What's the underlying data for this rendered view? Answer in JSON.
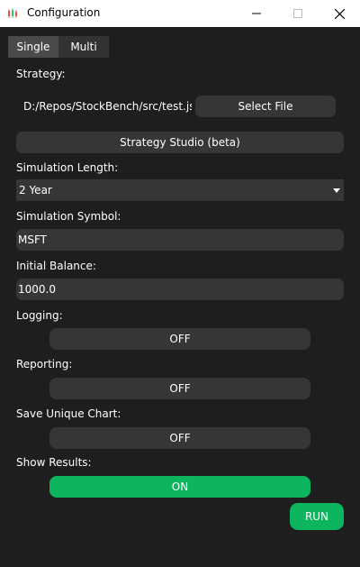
{
  "window": {
    "title": "Configuration",
    "icon": "candlestick-chart-icon",
    "controls": [
      "minimize-icon",
      "maximize-icon",
      "close-icon"
    ]
  },
  "tabs": [
    {
      "label": "Single",
      "active": true
    },
    {
      "label": "Multi",
      "active": false
    }
  ],
  "strategy": {
    "label": "Strategy:",
    "file_path": "D:/Repos/StockBench/src/test.json",
    "select_file_label": "Select File",
    "studio_label": "Strategy Studio (beta)"
  },
  "simulation_length": {
    "label": "Simulation Length:",
    "value": "2 Year"
  },
  "simulation_symbol": {
    "label": "Simulation Symbol:",
    "value": "MSFT"
  },
  "initial_balance": {
    "label": "Initial Balance:",
    "value": "1000.0"
  },
  "logging": {
    "label": "Logging:",
    "state": "OFF"
  },
  "reporting": {
    "label": "Reporting:",
    "state": "OFF"
  },
  "save_unique_chart": {
    "label": "Save Unique Chart:",
    "state": "OFF"
  },
  "show_results": {
    "label": "Show Results:",
    "state": "ON"
  },
  "run_label": "RUN",
  "colors": {
    "background": "#1e1e1e",
    "control": "#343638",
    "accent_green": "#0cb55e"
  }
}
